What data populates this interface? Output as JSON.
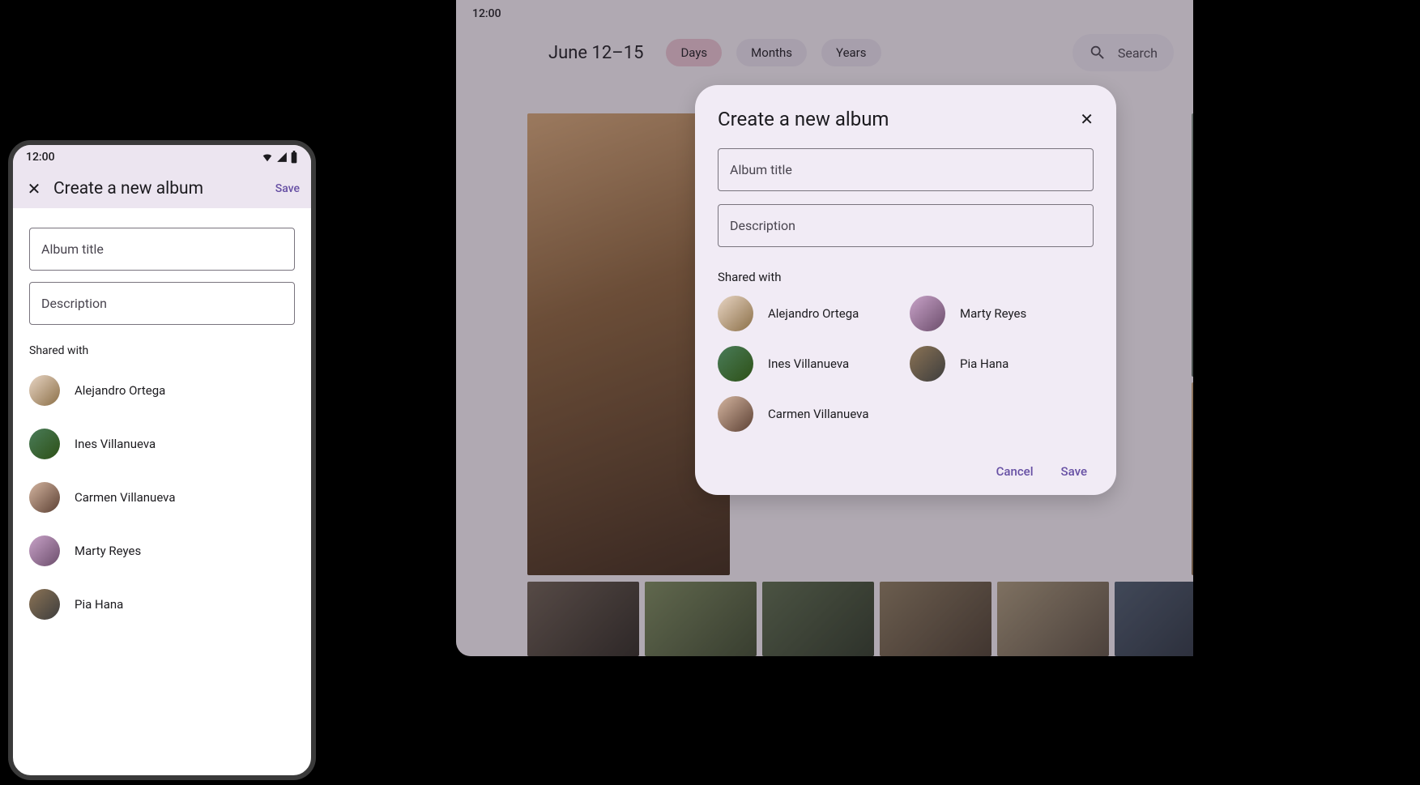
{
  "phone": {
    "status_time": "12:00",
    "header_title": "Create a new album",
    "save_label": "Save",
    "title_placeholder": "Album title",
    "desc_placeholder": "Description",
    "shared_label": "Shared with",
    "people": [
      {
        "name": "Alejandro Ortega"
      },
      {
        "name": "Ines Villanueva"
      },
      {
        "name": "Carmen Villanueva"
      },
      {
        "name": "Marty Reyes"
      },
      {
        "name": "Pia Hana"
      }
    ]
  },
  "tablet": {
    "status_time": "12:00",
    "date_range": "June 12–15",
    "chips": {
      "days": "Days",
      "months": "Months",
      "years": "Years"
    },
    "search_placeholder": "Search"
  },
  "dialog": {
    "title": "Create a new album",
    "title_placeholder": "Album title",
    "desc_placeholder": "Description",
    "shared_label": "Shared with",
    "people": [
      {
        "name": "Alejandro Ortega"
      },
      {
        "name": "Marty Reyes"
      },
      {
        "name": "Ines Villanueva"
      },
      {
        "name": "Pia Hana"
      },
      {
        "name": "Carmen Villanueva"
      }
    ],
    "cancel_label": "Cancel",
    "save_label": "Save"
  }
}
